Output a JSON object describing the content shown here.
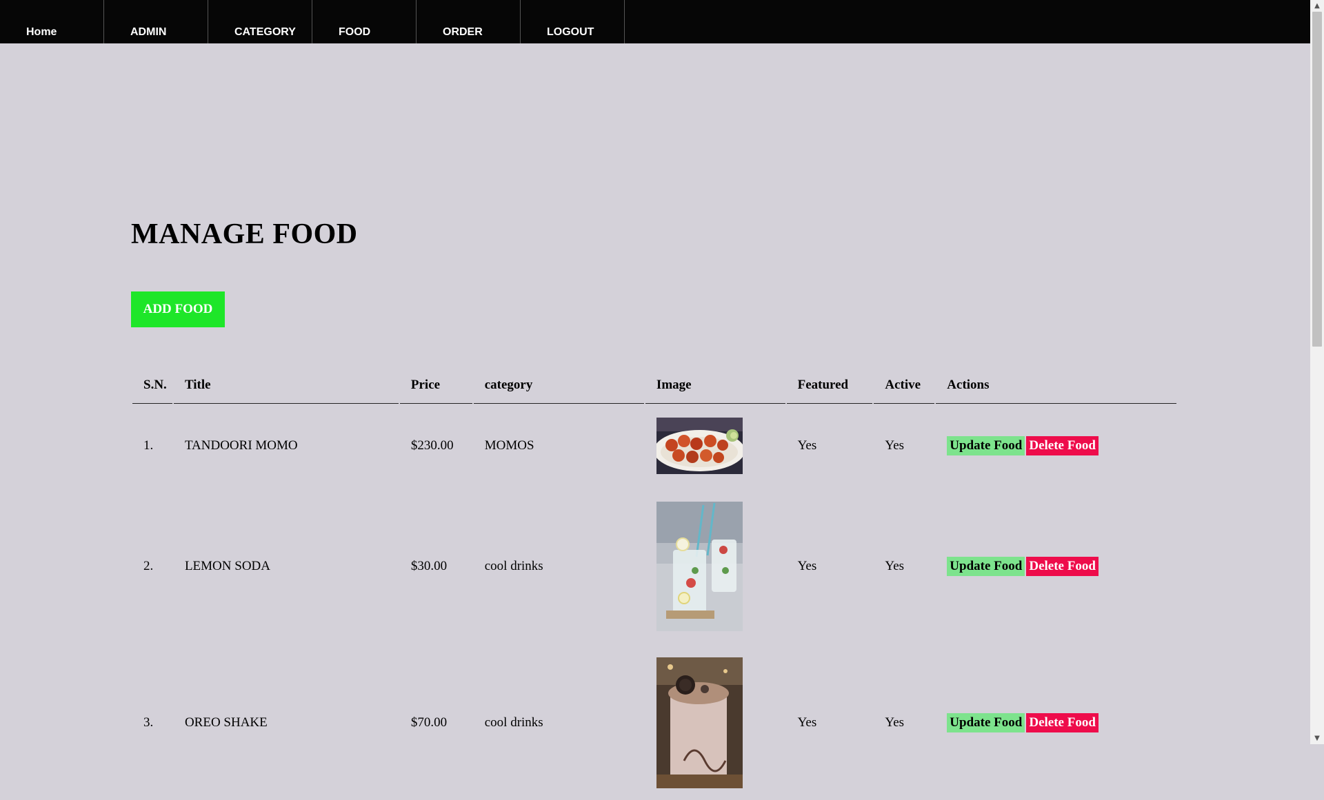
{
  "nav": {
    "items": [
      {
        "label": "Home"
      },
      {
        "label": "ADMIN"
      },
      {
        "label": "CATEGORY"
      },
      {
        "label": "FOOD"
      },
      {
        "label": "ORDER"
      },
      {
        "label": "LOGOUT"
      }
    ]
  },
  "main": {
    "title": "MANAGE FOOD",
    "add_button": "ADD FOOD"
  },
  "table": {
    "headers": [
      "S.N.",
      "Title",
      "Price",
      "category",
      "Image",
      "Featured",
      "Active",
      "Actions"
    ],
    "update_label": "Update Food",
    "delete_label": "Delete Food",
    "rows": [
      {
        "sn": "1.",
        "title": "TANDOORI MOMO",
        "price": "$230.00",
        "category": "MOMOS",
        "featured": "Yes",
        "active": "Yes"
      },
      {
        "sn": "2.",
        "title": "LEMON SODA",
        "price": "$30.00",
        "category": "cool drinks",
        "featured": "Yes",
        "active": "Yes"
      },
      {
        "sn": "3.",
        "title": "OREO SHAKE",
        "price": "$70.00",
        "category": "cool drinks",
        "featured": "Yes",
        "active": "Yes"
      }
    ]
  },
  "colors": {
    "nav_bg": "#060606",
    "page_bg": "#d4d1d9",
    "add_button": "#1ee629",
    "update_button": "#7de38d",
    "delete_button": "#ee0c4b"
  }
}
